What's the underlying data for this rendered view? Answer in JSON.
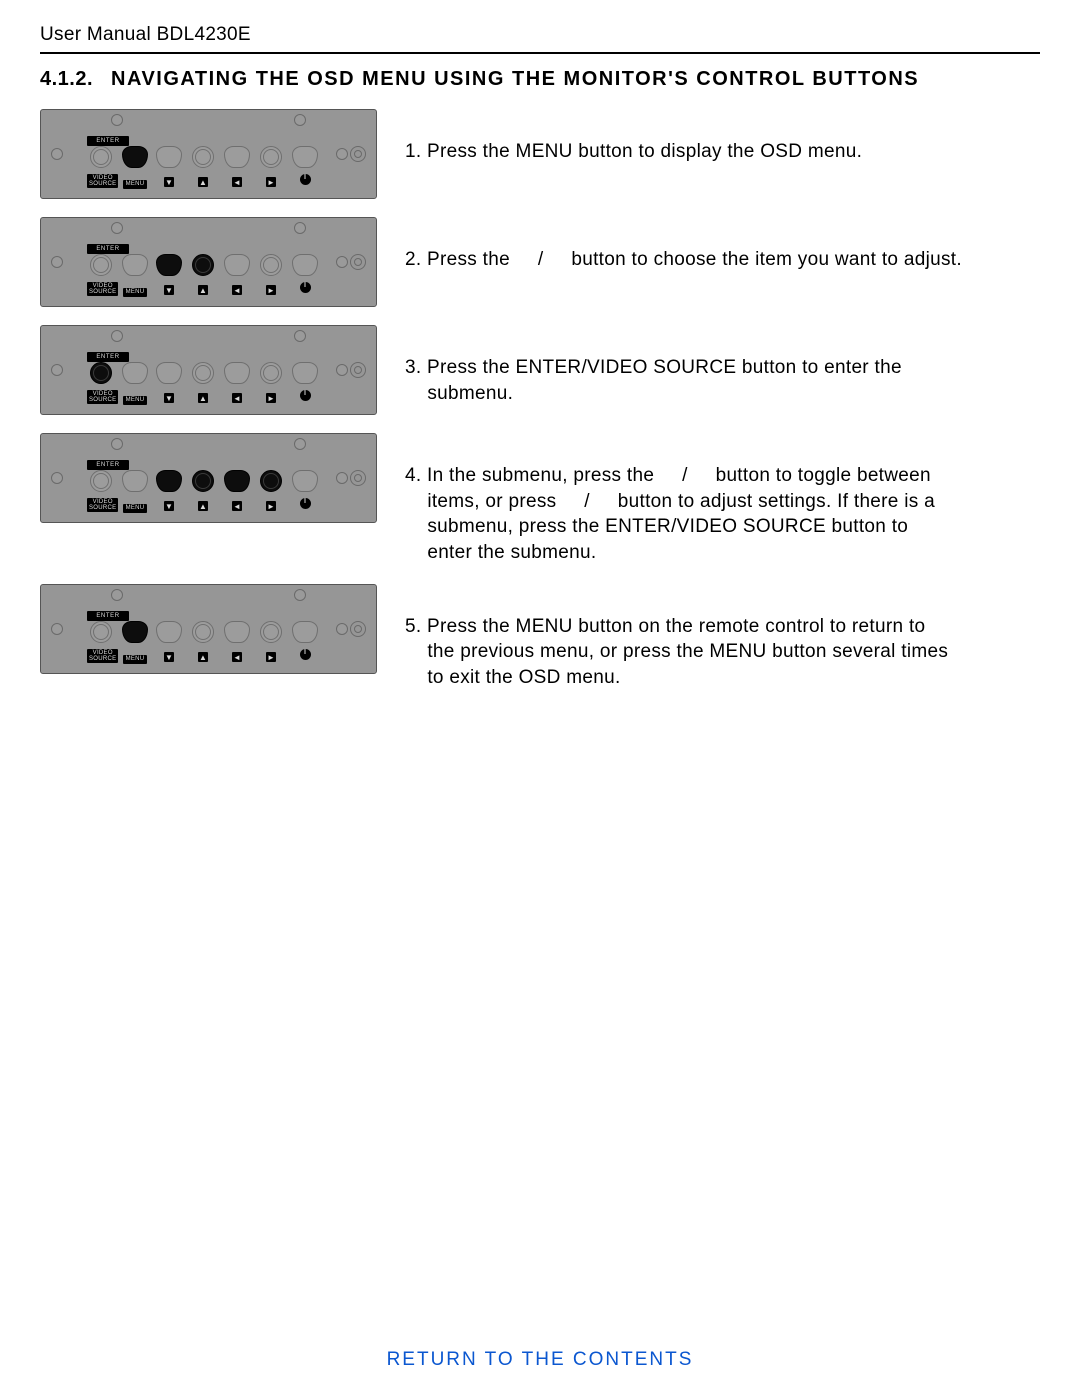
{
  "doc": {
    "title": "User Manual BDL4230E",
    "section_number": "4.1.2.",
    "section_title": "NAVIGATING THE OSD MENU USING THE MONITOR'S CONTROL BUTTONS"
  },
  "panel_labels": {
    "enter": "ENTER",
    "video_source": "VIDEO\nSOURCE",
    "menu": "MENU",
    "down": "▼",
    "up": "▲",
    "left": "◄",
    "right": "►",
    "power": "⏻"
  },
  "steps": [
    {
      "text": "1. Press the MENU button to display the OSD menu.",
      "highlight": [
        "menu"
      ]
    },
    {
      "text": "2. Press the     /     button to choose the item you want to adjust.",
      "highlight": [
        "down",
        "up"
      ]
    },
    {
      "text": "3. Press the ENTER/VIDEO SOURCE button to enter the \n    submenu.",
      "highlight": [
        "enter"
      ]
    },
    {
      "text": "4. In the submenu, press the     /     button to toggle between \n    items, or press     /     button to adjust settings. If there is a \n    submenu, press the ENTER/VIDEO SOURCE button to \n    enter the submenu.",
      "highlight": [
        "down",
        "up",
        "left",
        "right"
      ]
    },
    {
      "text": "5. Press the MENU button on the remote control to return to \n    the previous menu, or press the MENU button several times \n    to exit the OSD menu.",
      "highlight": [
        "menu"
      ]
    }
  ],
  "footer": {
    "return_link": "RETURN TO THE CONTENTS"
  }
}
